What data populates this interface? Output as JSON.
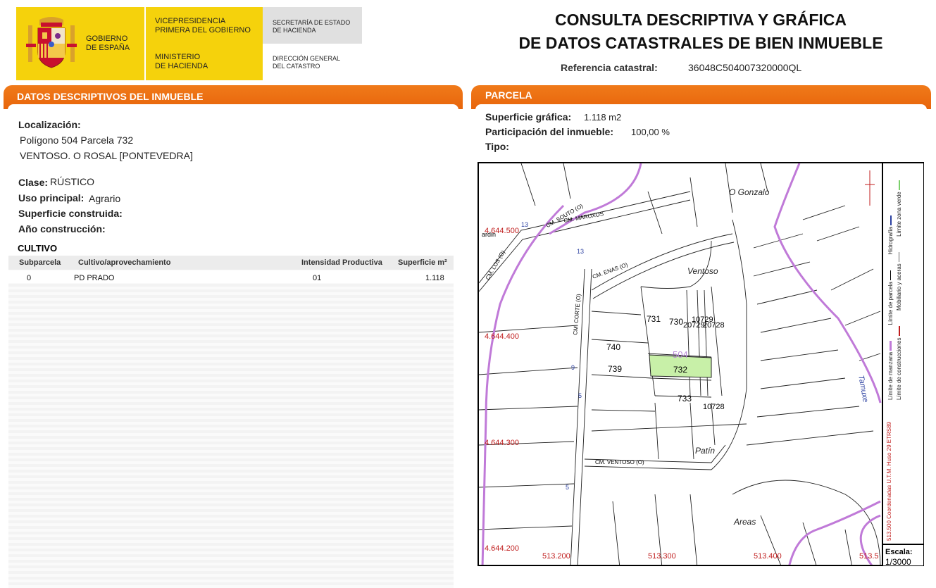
{
  "header": {
    "gobierno": "GOBIERNO\nDE ESPAÑA",
    "vicepresidencia": "VICEPRESIDENCIA\nPRIMERA DEL GOBIERNO",
    "ministerio": "MINISTERIO\nDE HACIENDA",
    "secretaria": "SECRETARÍA DE ESTADO\nDE HACIENDA",
    "direccion": "DIRECCIÓN GENERAL\nDEL CATASTRO",
    "title": "CONSULTA DESCRIPTIVA Y GRÁFICA\nDE DATOS CATASTRALES DE BIEN INMUEBLE",
    "ref_label": "Referencia catastral:",
    "ref_value": "36048C504007320000QL"
  },
  "colors": {
    "accent": "#e8650b",
    "logo_yellow": "#f5d20c",
    "parcel_highlight": "#c8f0a8",
    "hydro": "#c07ad8"
  },
  "left": {
    "tab_title": "DATOS DESCRIPTIVOS DEL INMUEBLE",
    "localizacion_label": "Localización:",
    "loc_line1": "Polígono 504 Parcela 732",
    "loc_line2": "VENTOSO. O ROSAL [PONTEVEDRA]",
    "clase_label": "Clase:",
    "clase_value": "RÚSTICO",
    "uso_label": "Uso principal:",
    "uso_value": "Agrario",
    "superficie_label": "Superficie construida:",
    "anio_label": "Año construcción:",
    "cultivo_title": "CULTIVO",
    "cultivo_headers": [
      "Subparcela",
      "Cultivo/aprovechamiento",
      "Intensidad Productiva",
      "Superficie m²"
    ],
    "cultivo_rows": [
      [
        "0",
        "PD PRADO",
        "01",
        "1.118"
      ]
    ]
  },
  "right": {
    "tab_title": "PARCELA",
    "sup_label": "Superficie gráfica:",
    "sup_value": "1.118 m2",
    "part_label": "Participación del inmueble:",
    "part_value": "100,00 %",
    "tipo_label": "Tipo:"
  },
  "map": {
    "place_names": [
      "O Gonzalo",
      "Ventoso",
      "Patín",
      "Areas",
      "Tamuxe"
    ],
    "parcel_labels": [
      "731",
      "730",
      "10729",
      "20729",
      "20728",
      "740",
      "739",
      "733",
      "10728"
    ],
    "highlighted_parcel": "732",
    "polygon_label": "504",
    "road_labels": [
      "CM. SOUTO (O)",
      "CM. MARUXOS",
      "CM. ENAS (O)",
      "CM. CORTE (O)",
      "CM. VENTOSO (O)",
      "CM. LOS (O)"
    ],
    "road_numbers": [
      "13",
      "13",
      "9",
      "5",
      "5"
    ],
    "y_coords": [
      "4.644.500",
      "4.644.400",
      "4.644.300",
      "4.644.200"
    ],
    "x_coords": [
      "513.200",
      "513.300",
      "513.400",
      "513.5"
    ],
    "corner_text": "ardin",
    "legend": [
      "Límite de manzana",
      "Límite de parcela",
      "Hidrografía",
      "Límite de construcciones",
      "Mobiliario y aceras",
      "Límite zona verde"
    ],
    "coord_system": "513.500 Coordenadas U.T.M. Huso 29 ETRS89",
    "scale_label": "Escala:",
    "scale_value": "1/3000"
  }
}
